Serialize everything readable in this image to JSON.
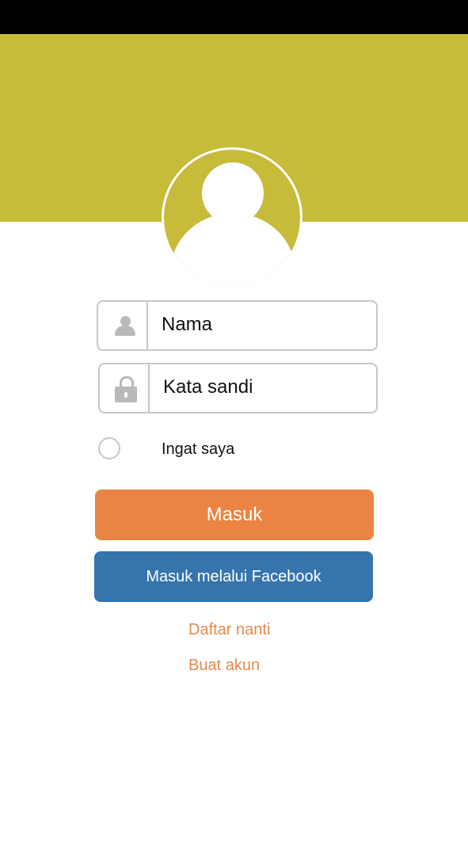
{
  "colors": {
    "status_bar": "#000000",
    "header": "#c7bb3a",
    "login_button": "#eb8443",
    "facebook_button": "#3574ad",
    "link_text": "#e5894d",
    "field_border": "#c8c8c8",
    "icon_gray": "#b9b9b9"
  },
  "header": {
    "avatar_icon": "user-avatar-icon"
  },
  "form": {
    "username": {
      "icon": "user-icon",
      "placeholder": "Nama"
    },
    "password": {
      "icon": "lock-icon",
      "placeholder": "Kata sandi"
    },
    "remember": {
      "label": "Ingat saya",
      "checked": false
    }
  },
  "actions": {
    "login_label": "Masuk",
    "facebook_label": "Masuk melalui Facebook",
    "later_label": "Daftar nanti",
    "create_label": "Buat akun"
  }
}
